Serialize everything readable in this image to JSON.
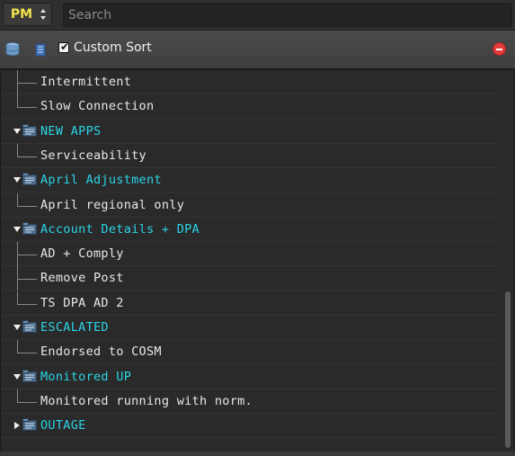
{
  "topbar": {
    "profile_selector": {
      "value": "PM"
    },
    "search": {
      "placeholder": "Search",
      "value": ""
    }
  },
  "toolbar": {
    "custom_sort_label": "Custom Sort",
    "custom_sort_checked": true,
    "icons": [
      "database-icon",
      "list-icon",
      "remove-icon"
    ]
  },
  "tree": {
    "rows": [
      {
        "type": "child",
        "label": "Intermittent"
      },
      {
        "type": "child",
        "label": "Slow Connection"
      },
      {
        "type": "group",
        "label": "NEW APPS",
        "expanded": true
      },
      {
        "type": "child",
        "label": "Serviceability"
      },
      {
        "type": "group",
        "label": "April Adjustment",
        "expanded": true
      },
      {
        "type": "child",
        "label": "April regional only"
      },
      {
        "type": "group",
        "label": "Account Details + DPA",
        "expanded": true
      },
      {
        "type": "child",
        "label": "AD + Comply"
      },
      {
        "type": "child",
        "label": "Remove Post"
      },
      {
        "type": "child",
        "label": "TS DPA AD 2"
      },
      {
        "type": "group",
        "label": "ESCALATED",
        "expanded": true
      },
      {
        "type": "child",
        "label": "Endorsed to COSM"
      },
      {
        "type": "group",
        "label": "Monitored UP",
        "expanded": true
      },
      {
        "type": "child",
        "label": "Monitored running with norm."
      },
      {
        "type": "group",
        "label": "OUTAGE",
        "expanded": false
      }
    ]
  },
  "colors": {
    "group_text": "#2ad4e6",
    "child_text": "#e8e8e8",
    "pm_text": "#f2e24a",
    "remove_button": "#e23b3b"
  }
}
